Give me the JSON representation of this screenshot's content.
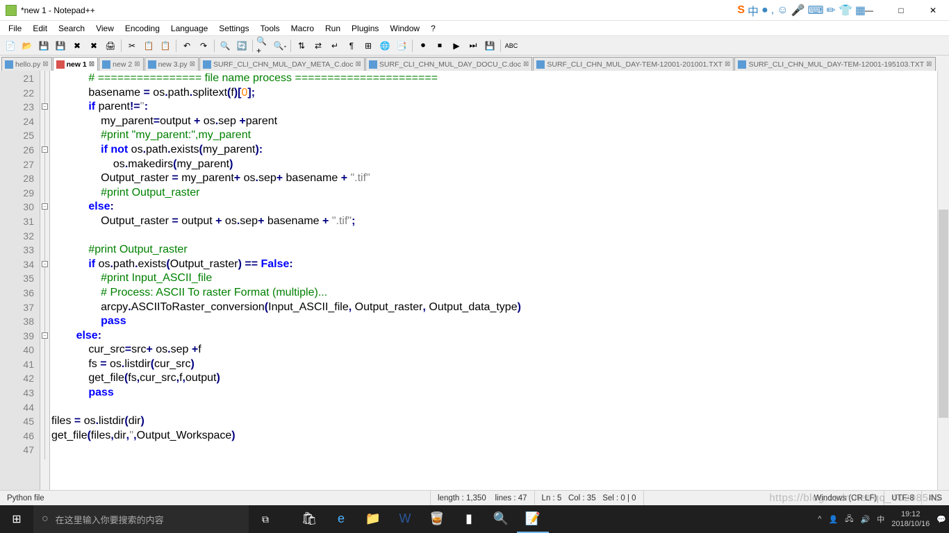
{
  "window": {
    "title": "*new 1 - Notepad++",
    "min": "—",
    "max": "□",
    "close": "✕"
  },
  "ime_icons": [
    "S",
    "中",
    "●",
    ",",
    "☺",
    "🎤",
    "⌨",
    "✏",
    "👕",
    "▦"
  ],
  "menu": [
    "File",
    "Edit",
    "Search",
    "View",
    "Encoding",
    "Language",
    "Settings",
    "Tools",
    "Macro",
    "Run",
    "Plugins",
    "Window",
    "?"
  ],
  "tabs": [
    {
      "label": "hello.py",
      "active": false
    },
    {
      "label": "new 1",
      "active": true
    },
    {
      "label": "new 2",
      "active": false
    },
    {
      "label": "new 3.py",
      "active": false
    },
    {
      "label": "SURF_CLI_CHN_MUL_DAY_META_C.doc",
      "active": false
    },
    {
      "label": "SURF_CLI_CHN_MUL_DAY_DOCU_C.doc",
      "active": false
    },
    {
      "label": "SURF_CLI_CHN_MUL_DAY-TEM-12001-201001.TXT",
      "active": false
    },
    {
      "label": "SURF_CLI_CHN_MUL_DAY-TEM-12001-195103.TXT",
      "active": false
    }
  ],
  "gutter_start": 21,
  "gutter_end": 47,
  "code_lines": [
    {
      "indent": "            ",
      "tokens": [
        {
          "t": "# ================ file name process ======================",
          "c": "c-comment"
        }
      ]
    },
    {
      "indent": "            ",
      "tokens": [
        {
          "t": "basename ",
          "c": ""
        },
        {
          "t": "=",
          "c": "c-op"
        },
        {
          "t": " os",
          "c": ""
        },
        {
          "t": ".",
          "c": "c-op"
        },
        {
          "t": "path",
          "c": ""
        },
        {
          "t": ".",
          "c": "c-op"
        },
        {
          "t": "splitext",
          "c": ""
        },
        {
          "t": "(",
          "c": "c-op"
        },
        {
          "t": "f",
          "c": ""
        },
        {
          "t": ")[",
          "c": "c-op"
        },
        {
          "t": "0",
          "c": "c-number"
        },
        {
          "t": "];",
          "c": "c-op"
        }
      ]
    },
    {
      "indent": "            ",
      "tokens": [
        {
          "t": "if",
          "c": "c-keyword"
        },
        {
          "t": " parent",
          "c": ""
        },
        {
          "t": "!=",
          "c": "c-op"
        },
        {
          "t": "''",
          "c": "c-string"
        },
        {
          "t": ":",
          "c": "c-op"
        }
      ]
    },
    {
      "indent": "                ",
      "tokens": [
        {
          "t": "my_parent",
          "c": ""
        },
        {
          "t": "=",
          "c": "c-op"
        },
        {
          "t": "output ",
          "c": ""
        },
        {
          "t": "+",
          "c": "c-op"
        },
        {
          "t": " os",
          "c": ""
        },
        {
          "t": ".",
          "c": "c-op"
        },
        {
          "t": "sep ",
          "c": ""
        },
        {
          "t": "+",
          "c": "c-op"
        },
        {
          "t": "parent",
          "c": ""
        }
      ]
    },
    {
      "indent": "                ",
      "tokens": [
        {
          "t": "#print \"my_parent:\",my_parent",
          "c": "c-comment"
        }
      ]
    },
    {
      "indent": "                ",
      "tokens": [
        {
          "t": "if",
          "c": "c-keyword"
        },
        {
          "t": " ",
          "c": ""
        },
        {
          "t": "not",
          "c": "c-keyword"
        },
        {
          "t": " os",
          "c": ""
        },
        {
          "t": ".",
          "c": "c-op"
        },
        {
          "t": "path",
          "c": ""
        },
        {
          "t": ".",
          "c": "c-op"
        },
        {
          "t": "exists",
          "c": ""
        },
        {
          "t": "(",
          "c": "c-op"
        },
        {
          "t": "my_parent",
          "c": ""
        },
        {
          "t": "):",
          "c": "c-op"
        }
      ]
    },
    {
      "indent": "                    ",
      "tokens": [
        {
          "t": "os",
          "c": ""
        },
        {
          "t": ".",
          "c": "c-op"
        },
        {
          "t": "makedirs",
          "c": ""
        },
        {
          "t": "(",
          "c": "c-op"
        },
        {
          "t": "my_parent",
          "c": ""
        },
        {
          "t": ")",
          "c": "c-op"
        }
      ]
    },
    {
      "indent": "                ",
      "tokens": [
        {
          "t": "Output_raster ",
          "c": ""
        },
        {
          "t": "=",
          "c": "c-op"
        },
        {
          "t": " my_parent",
          "c": ""
        },
        {
          "t": "+",
          "c": "c-op"
        },
        {
          "t": " os",
          "c": ""
        },
        {
          "t": ".",
          "c": "c-op"
        },
        {
          "t": "sep",
          "c": ""
        },
        {
          "t": "+",
          "c": "c-op"
        },
        {
          "t": " basename ",
          "c": ""
        },
        {
          "t": "+",
          "c": "c-op"
        },
        {
          "t": " ",
          "c": ""
        },
        {
          "t": "\".tif\"",
          "c": "c-string"
        }
      ]
    },
    {
      "indent": "                ",
      "tokens": [
        {
          "t": "#print Output_raster",
          "c": "c-comment"
        }
      ]
    },
    {
      "indent": "            ",
      "tokens": [
        {
          "t": "else",
          "c": "c-keyword"
        },
        {
          "t": ":",
          "c": "c-op"
        }
      ]
    },
    {
      "indent": "                ",
      "tokens": [
        {
          "t": "Output_raster ",
          "c": ""
        },
        {
          "t": "=",
          "c": "c-op"
        },
        {
          "t": " output ",
          "c": ""
        },
        {
          "t": "+",
          "c": "c-op"
        },
        {
          "t": " os",
          "c": ""
        },
        {
          "t": ".",
          "c": "c-op"
        },
        {
          "t": "sep",
          "c": ""
        },
        {
          "t": "+",
          "c": "c-op"
        },
        {
          "t": " basename ",
          "c": ""
        },
        {
          "t": "+",
          "c": "c-op"
        },
        {
          "t": " ",
          "c": ""
        },
        {
          "t": "\".tif\"",
          "c": "c-string"
        },
        {
          "t": ";",
          "c": "c-op"
        }
      ]
    },
    {
      "indent": "",
      "tokens": []
    },
    {
      "indent": "            ",
      "tokens": [
        {
          "t": "#print Output_raster",
          "c": "c-comment"
        }
      ]
    },
    {
      "indent": "            ",
      "tokens": [
        {
          "t": "if",
          "c": "c-keyword"
        },
        {
          "t": " os",
          "c": ""
        },
        {
          "t": ".",
          "c": "c-op"
        },
        {
          "t": "path",
          "c": ""
        },
        {
          "t": ".",
          "c": "c-op"
        },
        {
          "t": "exists",
          "c": ""
        },
        {
          "t": "(",
          "c": "c-op"
        },
        {
          "t": "Output_raster",
          "c": ""
        },
        {
          "t": ")",
          "c": "c-op"
        },
        {
          "t": " ",
          "c": ""
        },
        {
          "t": "==",
          "c": "c-op"
        },
        {
          "t": " ",
          "c": ""
        },
        {
          "t": "False",
          "c": "c-keyword"
        },
        {
          "t": ":",
          "c": "c-op"
        }
      ]
    },
    {
      "indent": "                ",
      "tokens": [
        {
          "t": "#print Input_ASCII_file",
          "c": "c-comment"
        }
      ]
    },
    {
      "indent": "                ",
      "tokens": [
        {
          "t": "# Process: ASCII To raster Format (multiple)...",
          "c": "c-comment"
        }
      ]
    },
    {
      "indent": "                ",
      "tokens": [
        {
          "t": "arcpy",
          "c": ""
        },
        {
          "t": ".",
          "c": "c-op"
        },
        {
          "t": "ASCIIToRaster_conversion",
          "c": ""
        },
        {
          "t": "(",
          "c": "c-op"
        },
        {
          "t": "Input_ASCII_file",
          "c": ""
        },
        {
          "t": ",",
          "c": "c-op"
        },
        {
          "t": " Output_raster",
          "c": ""
        },
        {
          "t": ",",
          "c": "c-op"
        },
        {
          "t": " Output_data_type",
          "c": ""
        },
        {
          "t": ")",
          "c": "c-op"
        }
      ]
    },
    {
      "indent": "                ",
      "tokens": [
        {
          "t": "pass",
          "c": "c-keyword"
        }
      ]
    },
    {
      "indent": "        ",
      "tokens": [
        {
          "t": "else",
          "c": "c-keyword"
        },
        {
          "t": ":",
          "c": "c-op"
        }
      ]
    },
    {
      "indent": "            ",
      "tokens": [
        {
          "t": "cur_src",
          "c": ""
        },
        {
          "t": "=",
          "c": "c-op"
        },
        {
          "t": "src",
          "c": ""
        },
        {
          "t": "+",
          "c": "c-op"
        },
        {
          "t": " os",
          "c": ""
        },
        {
          "t": ".",
          "c": "c-op"
        },
        {
          "t": "sep ",
          "c": ""
        },
        {
          "t": "+",
          "c": "c-op"
        },
        {
          "t": "f",
          "c": ""
        }
      ]
    },
    {
      "indent": "            ",
      "tokens": [
        {
          "t": "fs ",
          "c": ""
        },
        {
          "t": "=",
          "c": "c-op"
        },
        {
          "t": " os",
          "c": ""
        },
        {
          "t": ".",
          "c": "c-op"
        },
        {
          "t": "listdir",
          "c": ""
        },
        {
          "t": "(",
          "c": "c-op"
        },
        {
          "t": "cur_src",
          "c": ""
        },
        {
          "t": ")",
          "c": "c-op"
        }
      ]
    },
    {
      "indent": "            ",
      "tokens": [
        {
          "t": "get_file",
          "c": ""
        },
        {
          "t": "(",
          "c": "c-op"
        },
        {
          "t": "fs",
          "c": ""
        },
        {
          "t": ",",
          "c": "c-op"
        },
        {
          "t": "cur_src",
          "c": ""
        },
        {
          "t": ",",
          "c": "c-op"
        },
        {
          "t": "f",
          "c": ""
        },
        {
          "t": ",",
          "c": "c-op"
        },
        {
          "t": "output",
          "c": ""
        },
        {
          "t": ")",
          "c": "c-op"
        }
      ]
    },
    {
      "indent": "            ",
      "tokens": [
        {
          "t": "pass",
          "c": "c-keyword"
        }
      ]
    },
    {
      "indent": "",
      "tokens": []
    },
    {
      "indent": "",
      "tokens": [
        {
          "t": "files ",
          "c": ""
        },
        {
          "t": "=",
          "c": "c-op"
        },
        {
          "t": " os",
          "c": ""
        },
        {
          "t": ".",
          "c": "c-op"
        },
        {
          "t": "listdir",
          "c": ""
        },
        {
          "t": "(",
          "c": "c-op"
        },
        {
          "t": "dir",
          "c": "c-builtin"
        },
        {
          "t": ")",
          "c": "c-op"
        }
      ]
    },
    {
      "indent": "",
      "tokens": [
        {
          "t": "get_file",
          "c": ""
        },
        {
          "t": "(",
          "c": "c-op"
        },
        {
          "t": "files",
          "c": ""
        },
        {
          "t": ",",
          "c": "c-op"
        },
        {
          "t": "dir",
          "c": "c-builtin"
        },
        {
          "t": ",",
          "c": "c-op"
        },
        {
          "t": "''",
          "c": "c-string"
        },
        {
          "t": ",",
          "c": "c-op"
        },
        {
          "t": "Output_Workspace",
          "c": ""
        },
        {
          "t": ")",
          "c": "c-op"
        }
      ]
    },
    {
      "indent": "",
      "tokens": []
    }
  ],
  "fold_markers": [
    {
      "line": 23,
      "sym": "−"
    },
    {
      "line": 26,
      "sym": "−"
    },
    {
      "line": 30,
      "sym": "−"
    },
    {
      "line": 34,
      "sym": "−"
    },
    {
      "line": 39,
      "sym": "−"
    }
  ],
  "status": {
    "filetype": "Python file",
    "length_label": "length :",
    "length": "1,350",
    "lines_label": "lines :",
    "lines": "47",
    "ln_label": "Ln :",
    "ln": "5",
    "col_label": "Col :",
    "col": "35",
    "sel_label": "Sel :",
    "sel": "0 | 0",
    "eol": "Windows (CR LF)",
    "encoding": "UTF-8",
    "mode": "INS"
  },
  "taskbar": {
    "search_placeholder": "在这里输入你要搜索的内容",
    "time": "19:12",
    "date": "2018/10/16"
  },
  "watermark": "https://blog.csdn.net/qq_40298546"
}
